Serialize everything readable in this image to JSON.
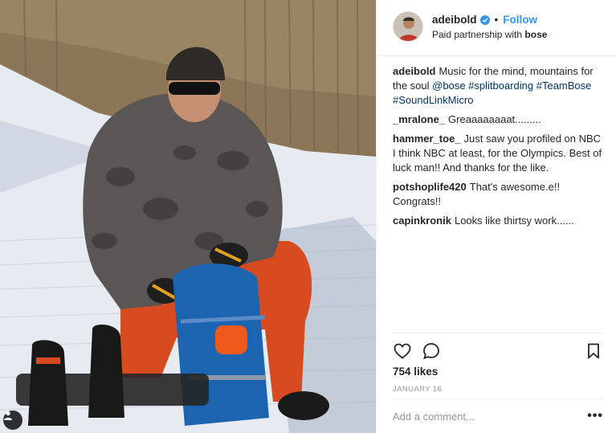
{
  "post": {
    "user_tag_icon": "person-icon"
  },
  "header": {
    "username": "adeibold",
    "verified_icon": "verified-badge-icon",
    "separator": "•",
    "follow_label": "Follow",
    "paid_prefix": "Paid partnership with",
    "partner": "bose"
  },
  "caption": {
    "author": "adeibold",
    "text": "Music for the mind, mountains for the soul",
    "tags": "@bose #splitboarding #TeamBose #SoundLinkMicro"
  },
  "comments": [
    {
      "author": "_mralone_",
      "text": "Greaaaaaaaat........."
    },
    {
      "author": "hammer_toe_",
      "text": "Just saw you profiled on NBC I think NBC at least, for the Olympics. Best of luck man!! And thanks for the like."
    },
    {
      "author": "potshoplife420",
      "text": "That's awesome.e!! Congrats!!"
    },
    {
      "author": "capinkronik",
      "text": "Looks like thirtsy work......"
    }
  ],
  "actions": {
    "like_icon": "heart-icon",
    "comment_icon": "comment-bubble-icon",
    "save_icon": "bookmark-icon"
  },
  "likes_text": "754 likes",
  "date_text": "JANUARY 16",
  "add_comment": {
    "placeholder": "Add a comment...",
    "more_label": "•••"
  }
}
